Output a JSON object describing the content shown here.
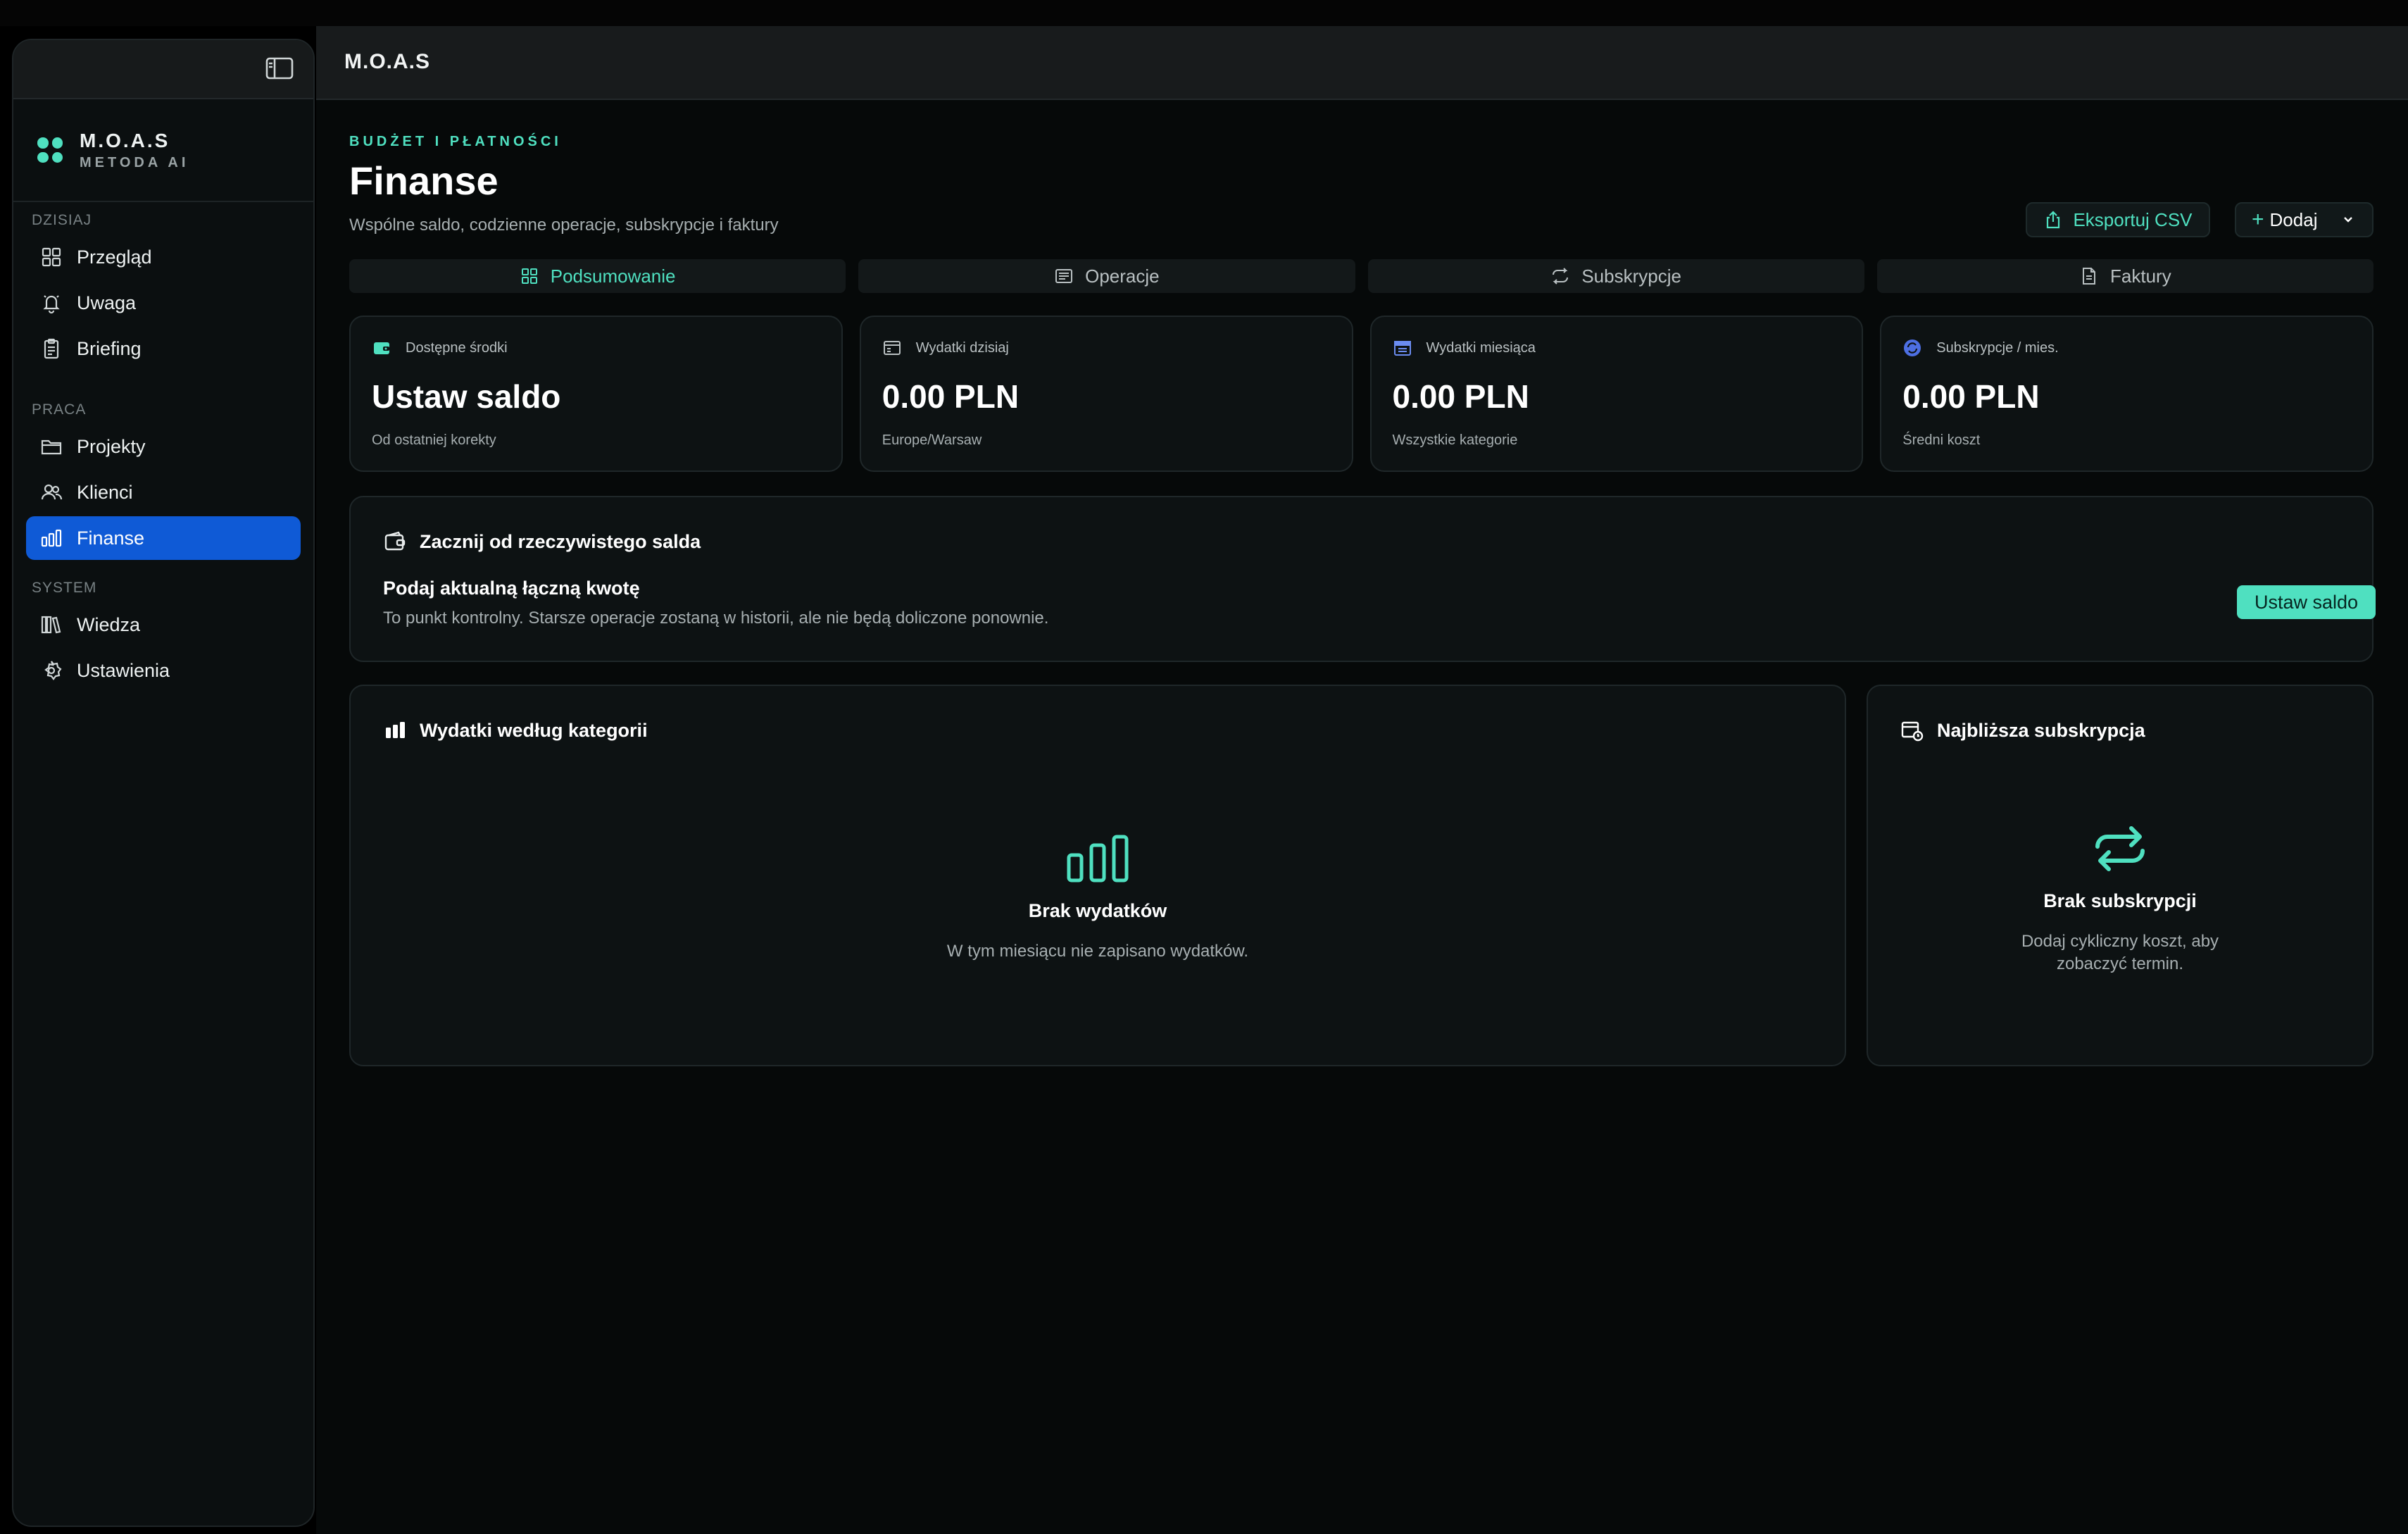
{
  "header": {
    "title": "M.O.A.S"
  },
  "sidebar": {
    "brand_title": "M.O.A.S",
    "brand_sub": "METODA AI",
    "sections": [
      {
        "label": "DZISIAJ",
        "items": [
          {
            "label": "Przegląd",
            "icon": "grid-icon"
          },
          {
            "label": "Uwaga",
            "icon": "bell-icon"
          },
          {
            "label": "Briefing",
            "icon": "clipboard-icon"
          }
        ]
      },
      {
        "label": "PRACA",
        "items": [
          {
            "label": "Projekty",
            "icon": "folder-icon"
          },
          {
            "label": "Klienci",
            "icon": "users-icon"
          },
          {
            "label": "Finanse",
            "icon": "chart-icon",
            "active": true
          }
        ]
      },
      {
        "label": "SYSTEM",
        "items": [
          {
            "label": "Wiedza",
            "icon": "library-icon"
          },
          {
            "label": "Ustawienia",
            "icon": "gear-icon"
          }
        ]
      }
    ]
  },
  "page": {
    "eyebrow": "BUDŻET I PŁATNOŚCI",
    "title": "Finanse",
    "subtitle": "Wspólne saldo, codzienne operacje, subskrypcje i faktury",
    "export_label": "Eksportuj CSV",
    "add_label": "Dodaj"
  },
  "tabs": [
    {
      "label": "Podsumowanie",
      "active": true
    },
    {
      "label": "Operacje"
    },
    {
      "label": "Subskrypcje"
    },
    {
      "label": "Faktury"
    }
  ],
  "stats": [
    {
      "label": "Dostępne środki",
      "value": "Ustaw saldo",
      "foot": "Od ostatniej korekty"
    },
    {
      "label": "Wydatki dzisiaj",
      "value": "0.00 PLN",
      "foot": "Europe/Warsaw"
    },
    {
      "label": "Wydatki miesiąca",
      "value": "0.00 PLN",
      "foot": "Wszystkie kategorie"
    },
    {
      "label": "Subskrypcje / mies.",
      "value": "0.00 PLN",
      "foot": "Średni koszt"
    }
  ],
  "callout": {
    "title": "Zacznij od rzeczywistego salda",
    "heading": "Podaj aktualną łączną kwotę",
    "text": "To punkt kontrolny. Starsze operacje zostaną w historii, ale nie będą doliczone ponownie.",
    "button": "Ustaw saldo"
  },
  "panels": {
    "spending": {
      "title": "Wydatki według kategorii",
      "empty_title": "Brak wydatków",
      "empty_text": "W tym miesiącu nie zapisano wydatków."
    },
    "subscription": {
      "title": "Najbliższa subskrypcja",
      "empty_title": "Brak subskrypcji",
      "empty_text_1": "Dodaj cykliczny koszt, aby",
      "empty_text_2": "zobaczyć termin."
    }
  },
  "colors": {
    "accent": "#4fe0c0",
    "active_nav": "#0f5ad6",
    "background": "#060909"
  }
}
